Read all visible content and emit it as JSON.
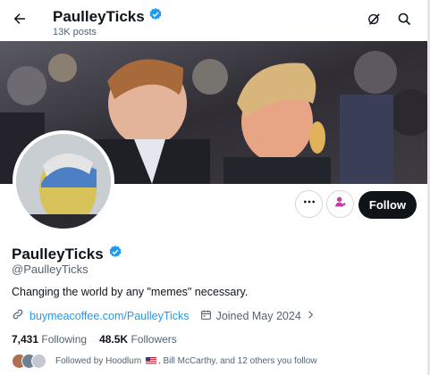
{
  "header": {
    "name": "PaulleyTicks",
    "posts": "13K posts",
    "back_icon": "arrow-left-icon",
    "grok_icon": "grok-icon",
    "search_icon": "search-icon"
  },
  "profile": {
    "display_name": "PaulleyTicks",
    "handle": "@PaulleyTicks",
    "bio": "Changing the world by any \"memes\" necessary.",
    "website": "buymeacoffee.com/PaulleyTicks",
    "joined": "Joined May 2024",
    "following_count": "7,431",
    "following_label": "Following",
    "followers_count": "48.5K",
    "followers_label": "Followers",
    "followed_by_prefix": "Followed by Hoodlum",
    "followed_by_suffix": ", Bill McCarthy, and 12 others you follow"
  },
  "actions": {
    "more_icon": "more-icon",
    "subscribe_icon": "subscribe-icon",
    "follow_label": "Follow"
  },
  "colors": {
    "accent": "#1d9bf0",
    "text": "#0f1419",
    "muted": "#536471",
    "follow_bg": "#0f1419",
    "subscribe_pink": "#c83aa8"
  }
}
